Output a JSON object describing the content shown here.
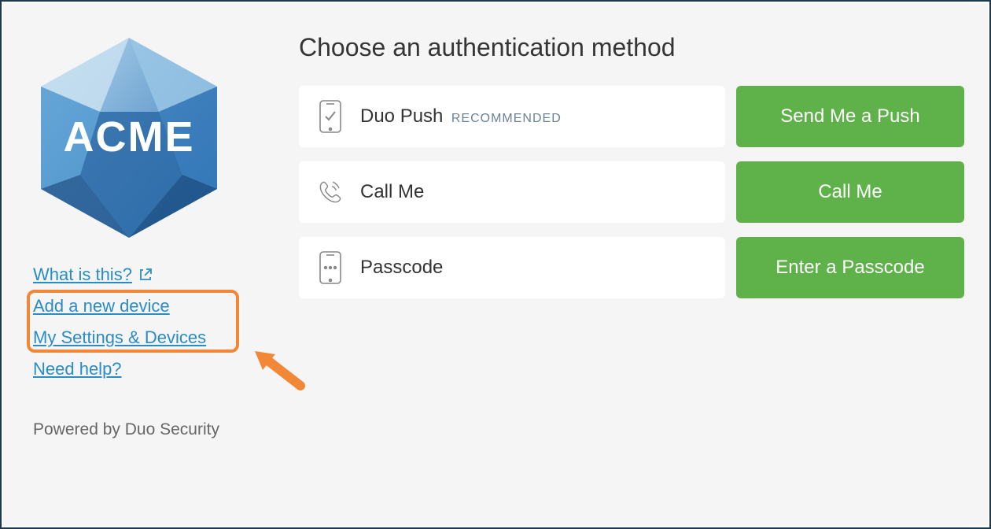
{
  "sidebar": {
    "logo_text": "ACME",
    "links": {
      "what_is_this": "What is this?",
      "add_device": "Add a new device",
      "settings_devices": "My Settings & Devices",
      "need_help": "Need help?"
    },
    "powered_by": "Powered by Duo Security"
  },
  "main": {
    "title": "Choose an authentication method",
    "methods": [
      {
        "icon": "phone-check-icon",
        "label": "Duo Push",
        "badge": "RECOMMENDED",
        "button_label": "Send Me a Push"
      },
      {
        "icon": "phone-call-icon",
        "label": "Call Me",
        "badge": "",
        "button_label": "Call Me"
      },
      {
        "icon": "phone-passcode-icon",
        "label": "Passcode",
        "badge": "",
        "button_label": "Enter a Passcode"
      }
    ]
  },
  "colors": {
    "accent_blue": "#2a8cc7",
    "button_green": "#5fb14a",
    "annotation_orange": "#f08838"
  }
}
